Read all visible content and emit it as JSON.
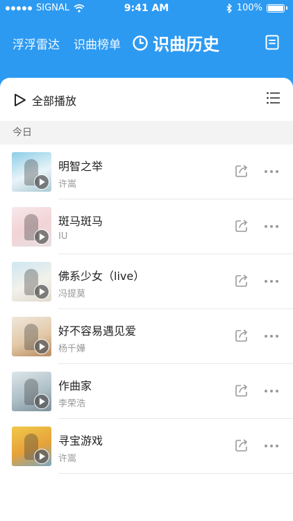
{
  "status_bar": {
    "carrier": "SIGNAL",
    "time": "9:41 AM",
    "battery": "100%"
  },
  "nav": {
    "tab_radar": "浮浮雷达",
    "tab_chart": "识曲榜单",
    "tab_history": "识曲历史"
  },
  "toolbar": {
    "play_all": "全部播放"
  },
  "section": {
    "title": "今日"
  },
  "songs": [
    {
      "title": "明智之举",
      "artist": "许嵩"
    },
    {
      "title": "斑马斑马",
      "artist": "IU"
    },
    {
      "title": "佛系少女（live）",
      "artist": "冯提莫"
    },
    {
      "title": "好不容易遇见爱",
      "artist": "杨千嬅"
    },
    {
      "title": "作曲家",
      "artist": "李荣浩"
    },
    {
      "title": "寻宝游戏",
      "artist": "许嵩"
    }
  ],
  "colors": {
    "header_blue": "#2d9af2"
  }
}
